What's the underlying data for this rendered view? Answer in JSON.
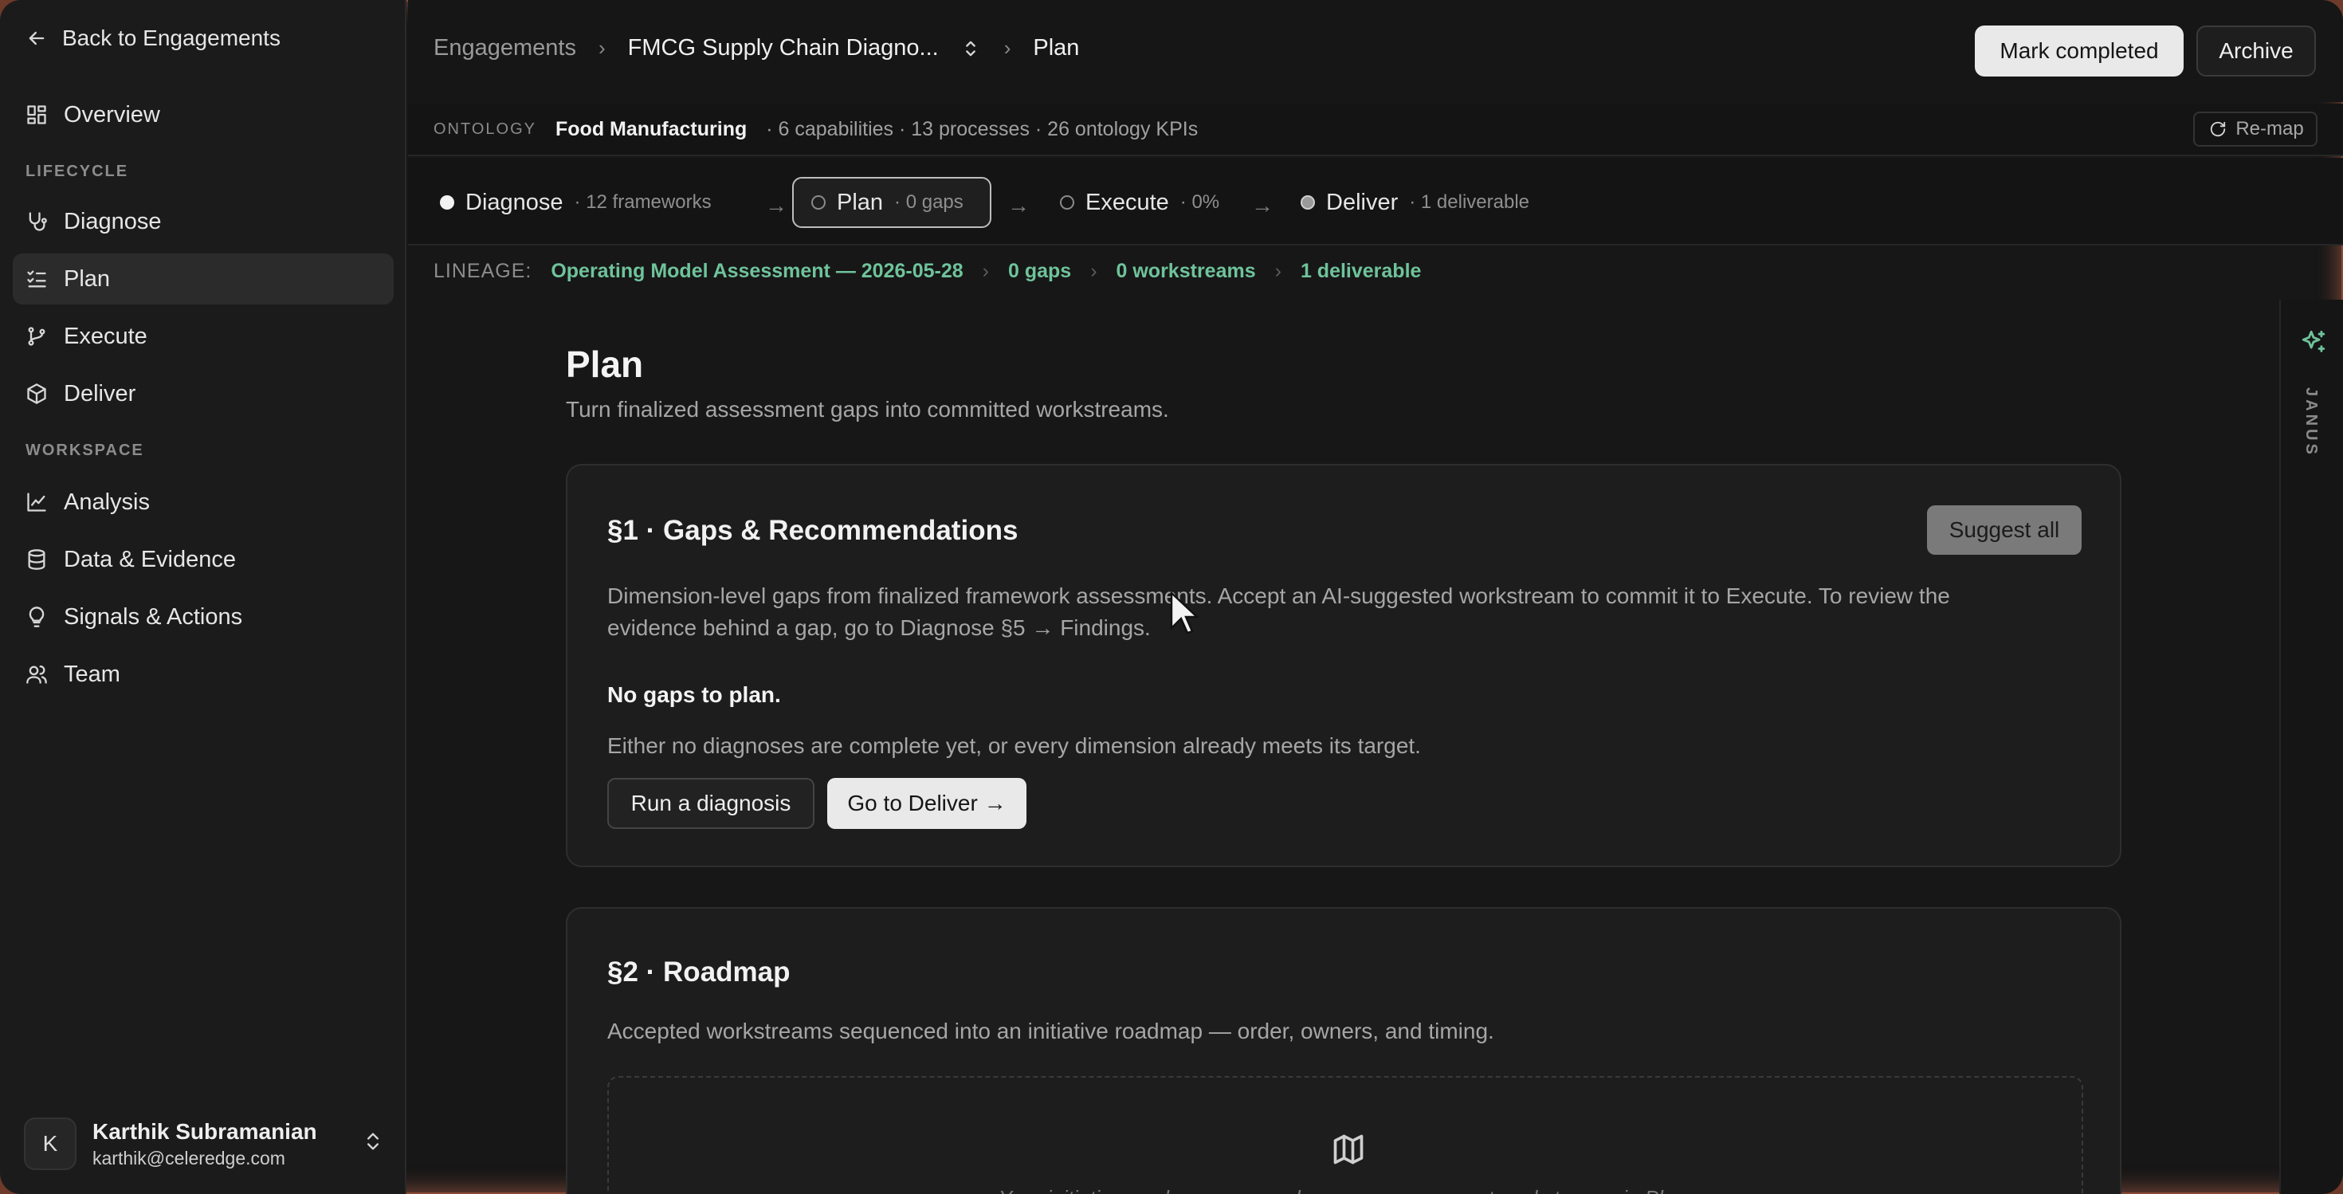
{
  "sidebar": {
    "back_label": "Back to Engagements",
    "overview_label": "Overview",
    "lifecycle_heading": "LIFECYCLE",
    "lifecycle_items": [
      {
        "label": "Diagnose"
      },
      {
        "label": "Plan"
      },
      {
        "label": "Execute"
      },
      {
        "label": "Deliver"
      }
    ],
    "workspace_heading": "WORKSPACE",
    "workspace_items": [
      {
        "label": "Analysis"
      },
      {
        "label": "Data & Evidence"
      },
      {
        "label": "Signals & Actions"
      },
      {
        "label": "Team"
      }
    ],
    "user": {
      "initial": "K",
      "name": "Karthik Subramanian",
      "email": "karthik@celeredge.com"
    }
  },
  "header": {
    "breadcrumb": [
      "Engagements",
      "FMCG Supply Chain Diagno...",
      "Plan"
    ],
    "mark_completed_label": "Mark completed",
    "archive_label": "Archive"
  },
  "ontology": {
    "label": "ONTOLOGY",
    "name": "Food Manufacturing",
    "meta": "· 6 capabilities · 13 processes · 26 ontology KPIs",
    "remap_label": "Re-map"
  },
  "stages": [
    {
      "label": "Diagnose",
      "meta": "· 12 frameworks"
    },
    {
      "label": "Plan",
      "meta": "· 0 gaps"
    },
    {
      "label": "Execute",
      "meta": "· 0%"
    },
    {
      "label": "Deliver",
      "meta": "· 1 deliverable"
    }
  ],
  "lineage": {
    "label": "LINEAGE:",
    "items": [
      "Operating Model Assessment — 2026-05-28",
      "0 gaps",
      "0 workstreams",
      "1 deliverable"
    ]
  },
  "page": {
    "title": "Plan",
    "subtitle": "Turn finalized assessment gaps into committed workstreams."
  },
  "gaps_card": {
    "title": "§1 · Gaps & Recommendations",
    "suggest_label": "Suggest all",
    "desc_line1": "Dimension-level gaps from finalized framework assessments. Accept an AI-suggested workstream to commit it to Execute. To review the",
    "desc_line2": "evidence behind a gap, go to Diagnose §5 → Findings.",
    "empty_title": "No gaps to plan.",
    "empty_desc": "Either no diagnoses are complete yet, or every dimension already meets its target.",
    "run_label": "Run a diagnosis",
    "deliver_label": "Go to Deliver →"
  },
  "roadmap_card": {
    "title": "§2 · Roadmap",
    "desc": "Accepted workstreams sequenced into an initiative roadmap — order, owners, and timing.",
    "empty_msg": "Your initiative roadmap appears here once you accept workstreams in Plan."
  },
  "rail": {
    "label": "JANUS"
  }
}
